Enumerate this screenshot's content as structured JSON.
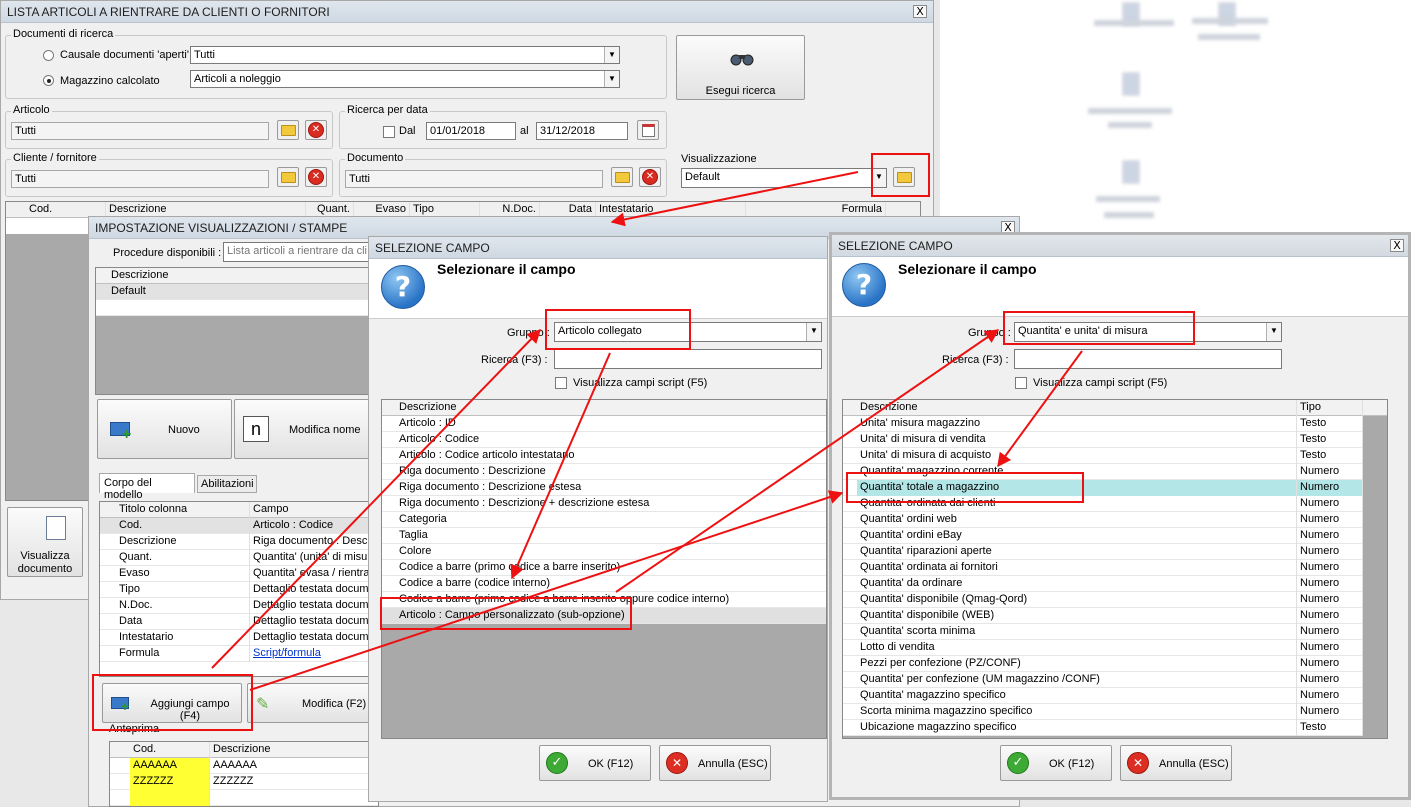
{
  "main": {
    "title": "LISTA ARTICOLI A RIENTRARE DA CLIENTI O FORNITORI",
    "close": "X",
    "doc_group": "Documenti di ricerca",
    "radio1_label": "Causale documenti 'aperti'",
    "radio1_value": "Tutti",
    "radio2_label": "Magazzino calcolato",
    "radio2_value": "Articoli a noleggio",
    "search_button": "Esegui ricerca",
    "articolo_group": "Articolo",
    "articolo_value": "Tutti",
    "ricerca_data_group": "Ricerca per data",
    "dal_label": "Dal",
    "dal_value": "01/01/2018",
    "al_label": "al",
    "al_value": "31/12/2018",
    "cliente_group": "Cliente / fornitore",
    "cliente_value": "Tutti",
    "documento_group": "Documento",
    "documento_value": "Tutti",
    "visualizzazione_group": "Visualizzazione",
    "visualizzazione_value": "Default",
    "grid_headers": [
      "Cod.",
      "Descrizione",
      "Quant.",
      "Evaso",
      "Tipo",
      "N.Doc.",
      "Data",
      "Intestatario",
      "Formula"
    ],
    "visualizza_documento": "Visualizza documento"
  },
  "imp": {
    "title": "IMPOSTAZIONE VISUALIZZAZIONI / STAMPE",
    "close": "X",
    "procedure_label": "Procedure disponibili :",
    "procedure_placeholder": "Lista articoli a rientrare da cli",
    "list_header": "Descrizione",
    "list_item": "Default",
    "nuovo": "Nuovo",
    "modifica_nome": "Modifica nome",
    "modifica_icon_letter": "n",
    "tab1": "Corpo del modello",
    "tab2": "Abilitazioni",
    "col_titolo": "Titolo colonna",
    "col_campo": "Campo",
    "rows": [
      {
        "titolo": "Cod.",
        "campo": "Articolo : Codice"
      },
      {
        "titolo": "Descrizione",
        "campo": "Riga documento : Descr"
      },
      {
        "titolo": "Quant.",
        "campo": "Quantita' (unita' di misur"
      },
      {
        "titolo": "Evaso",
        "campo": "Quantita' evasa / rientra"
      },
      {
        "titolo": "Tipo",
        "campo": "Dettaglio testata docum"
      },
      {
        "titolo": "N.Doc.",
        "campo": "Dettaglio testata docum"
      },
      {
        "titolo": "Data",
        "campo": "Dettaglio testata docum"
      },
      {
        "titolo": "Intestatario",
        "campo": "Dettaglio testata docum"
      },
      {
        "titolo": "Formula",
        "campo": "Script/formula"
      }
    ],
    "aggiungi": "Aggiungi campo (F4)",
    "modifica": "Modifica (F2)",
    "anteprima": "Anteprima",
    "prev_headers": [
      "Cod.",
      "Descrizione"
    ],
    "prev_rows": [
      {
        "cod": "AAAAAA",
        "desc": "AAAAAA"
      },
      {
        "cod": "ZZZZZZ",
        "desc": "ZZZZZZ"
      }
    ]
  },
  "sel1": {
    "title": "SELEZIONE CAMPO",
    "heading": "Selezionare il campo",
    "gruppo_label": "Gruppo :",
    "gruppo_value": "Articolo collegato",
    "ricerca_label": "Ricerca (F3) :",
    "script_label": "Visualizza campi script (F5)",
    "list_header": "Descrizione",
    "items": [
      "Articolo : ID",
      "Articolo : Codice",
      "Articolo : Codice articolo intestatario",
      "Riga documento : Descrizione",
      "Riga documento : Descrizione estesa",
      "Riga documento : Descrizione + descrizione estesa",
      "Categoria",
      "Taglia",
      "Colore",
      "Codice a barre (primo codice a barre inserito)",
      "Codice a barre (codice interno)",
      "Codice a barre (primo codice a barre inserito oppure codice interno)",
      "Articolo : Campo personalizzato (sub-opzione)"
    ],
    "ok": "OK (F12)",
    "annulla": "Annulla (ESC)"
  },
  "sel2": {
    "title": "SELEZIONE CAMPO",
    "close": "X",
    "heading": "Selezionare il campo",
    "gruppo_label": "Gruppo :",
    "gruppo_value": "Quantita' e unita' di misura",
    "ricerca_label": "Ricerca (F3) :",
    "script_label": "Visualizza campi script (F5)",
    "col_desc": "Descrizione",
    "col_tipo": "Tipo",
    "items": [
      {
        "d": "Unita' misura magazzino",
        "t": "Testo"
      },
      {
        "d": "Unita' di misura di vendita",
        "t": "Testo"
      },
      {
        "d": "Unita' di misura di acquisto",
        "t": "Testo"
      },
      {
        "d": "Quantita' magazzino corrente",
        "t": "Numero"
      },
      {
        "d": "Quantita' totale a magazzino",
        "t": "Numero"
      },
      {
        "d": "Quantita' ordinata dai clienti",
        "t": "Numero"
      },
      {
        "d": "Quantita' ordini web",
        "t": "Numero"
      },
      {
        "d": "Quantita' ordini eBay",
        "t": "Numero"
      },
      {
        "d": "Quantita' riparazioni aperte",
        "t": "Numero"
      },
      {
        "d": "Quantita' ordinata ai fornitori",
        "t": "Numero"
      },
      {
        "d": "Quantita' da ordinare",
        "t": "Numero"
      },
      {
        "d": "Quantita' disponibile (Qmag-Qord)",
        "t": "Numero"
      },
      {
        "d": "Quantita' disponibile (WEB)",
        "t": "Numero"
      },
      {
        "d": "Quantita' scorta minima",
        "t": "Numero"
      },
      {
        "d": "Lotto di vendita",
        "t": "Numero"
      },
      {
        "d": "Pezzi per confezione (PZ/CONF)",
        "t": "Numero"
      },
      {
        "d": "Quantita' per confezione (UM magazzino /CONF)",
        "t": "Numero"
      },
      {
        "d": "Quantita' magazzino specifico",
        "t": "Numero"
      },
      {
        "d": "Scorta minima magazzino specifico",
        "t": "Numero"
      },
      {
        "d": "Ubicazione magazzino specifico",
        "t": "Testo"
      }
    ],
    "ok": "OK (F12)",
    "annulla": "Annulla (ESC)"
  },
  "colors": {
    "highlight_row": "#b3e6e6",
    "preview_yellow": "#ffff33",
    "annotation_red": "#e11111"
  }
}
